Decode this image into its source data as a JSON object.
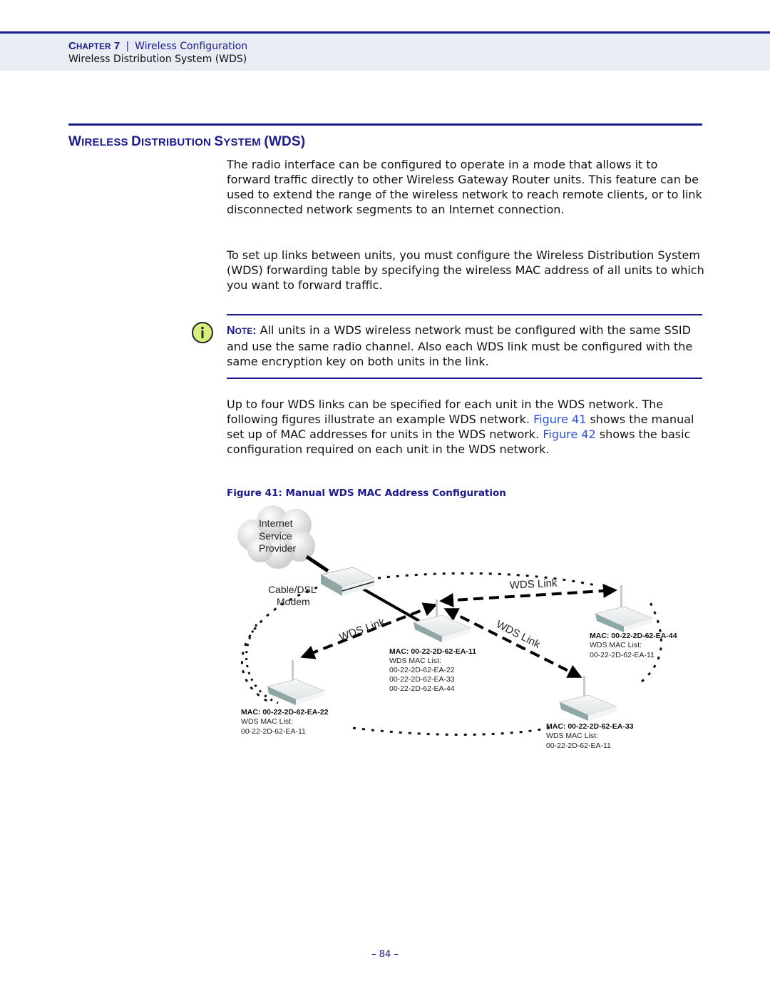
{
  "header": {
    "chapter_label_first": "C",
    "chapter_label_rest": "HAPTER",
    "chapter_number": "7",
    "separator": "|",
    "chapter_title": "Wireless Configuration",
    "section_breadcrumb": "Wireless Distribution System (WDS)"
  },
  "section": {
    "title_parts": [
      {
        "cap": "W",
        "rest": "IRELESS "
      },
      {
        "cap": "D",
        "rest": "ISTRIBUTION "
      },
      {
        "cap": "S",
        "rest": "YSTEM "
      },
      {
        "cap": "(WDS)",
        "rest": ""
      }
    ]
  },
  "paragraphs": {
    "p1": "The radio interface can be configured to operate in a mode that allows it to forward traffic directly to other Wireless Gateway Router units. This feature can be used to extend the range of the wireless network to reach remote clients, or to link disconnected network segments to an Internet connection.",
    "p2": "To set up links between units, you must configure the Wireless Distribution System (WDS) forwarding table by specifying the wireless MAC address of all units to which you want to forward traffic.",
    "p3_a": "Up to four WDS links can be specified for each unit in the WDS network. The following figures illustrate an example WDS network. ",
    "p3_link1": "Figure 41",
    "p3_b": " shows the manual set up of MAC addresses for units in the WDS network. ",
    "p3_link2": "Figure 42",
    "p3_c": " shows the basic configuration required on each unit in the WDS network."
  },
  "note": {
    "label_cap": "N",
    "label_rest": "OTE",
    "label_colon": ":",
    "text": " All units in a WDS wireless network must be configured with the same SSID and use the same radio channel. Also each WDS link must be configured with the same encryption key on both units in the link.",
    "icon": "info-icon",
    "icon_color": "#d4f07a"
  },
  "figure": {
    "caption": "Figure 41:  Manual WDS MAC Address Configuration",
    "cloud_lines": [
      "Internet",
      "Service",
      "Provider"
    ],
    "modem_lines": [
      "Cable/DSL",
      "Modem"
    ],
    "link_label": "WDS Link",
    "mac_list_label": "WDS MAC List:",
    "units": [
      {
        "id": "center",
        "mac": "MAC: 00-22-2D-62-EA-11",
        "list": [
          "00-22-2D-62-EA-22",
          "00-22-2D-62-EA-33",
          "00-22-2D-62-EA-44"
        ]
      },
      {
        "id": "left",
        "mac": "MAC: 00-22-2D-62-EA-22",
        "list": [
          "00-22-2D-62-EA-11"
        ]
      },
      {
        "id": "bottom-right",
        "mac": "MAC: 00-22-2D-62-EA-33",
        "list": [
          "00-22-2D-62-EA-11"
        ]
      },
      {
        "id": "top-right",
        "mac": "MAC: 00-22-2D-62-EA-44",
        "list": [
          "00-22-2D-62-EA-11"
        ]
      }
    ]
  },
  "footer": {
    "page_number": "–  84  –"
  },
  "colors": {
    "brand_blue": "#1a1a8c",
    "link_blue": "#2a52d8",
    "header_band": "#e8ecf3"
  }
}
